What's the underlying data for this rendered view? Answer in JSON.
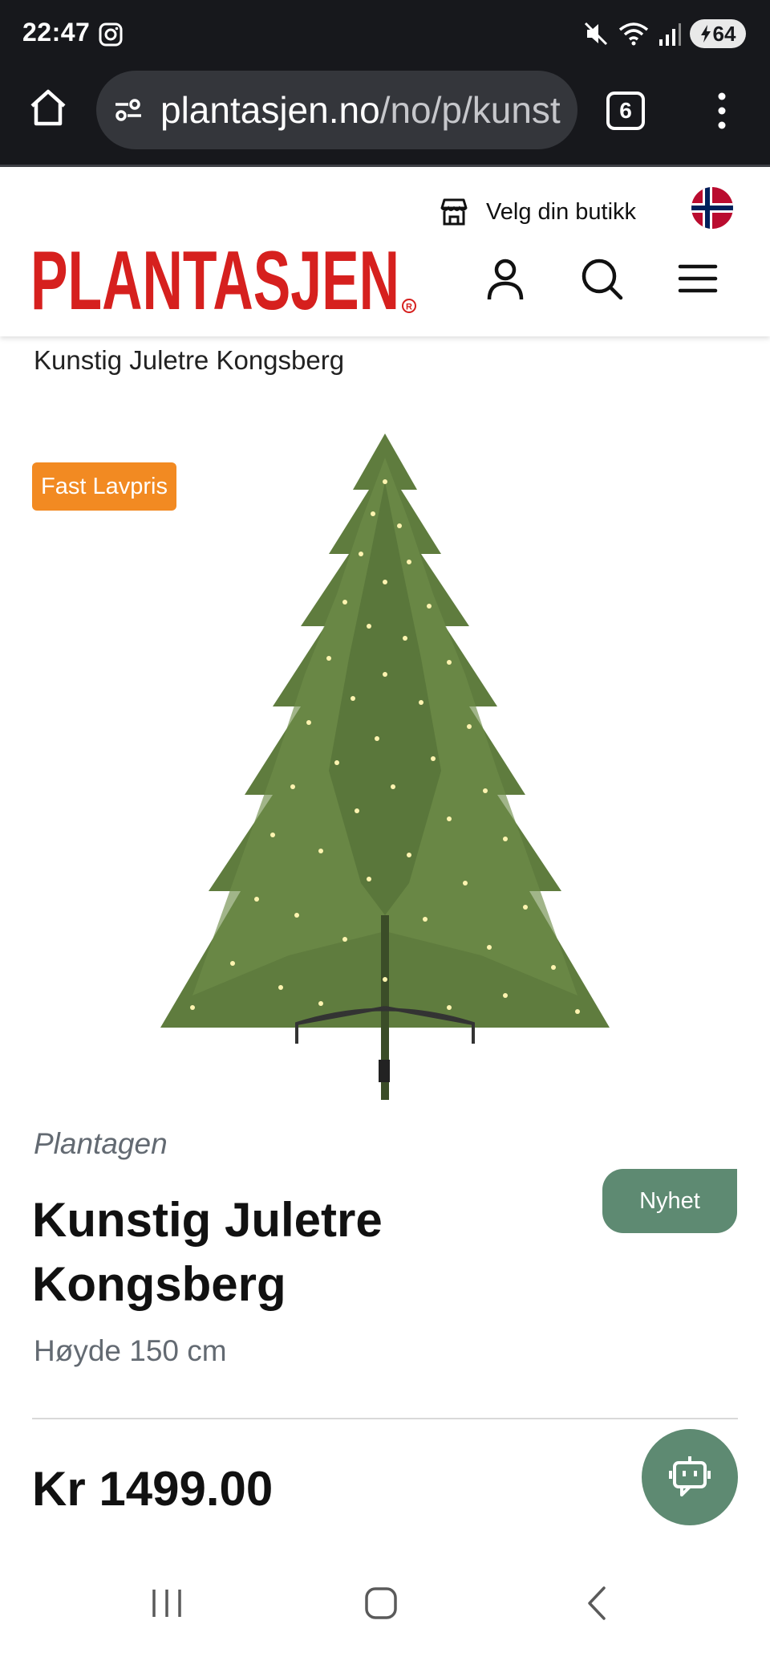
{
  "status_bar": {
    "time": "22:47",
    "battery": "64",
    "icons": [
      "instagram-icon",
      "mute-icon",
      "wifi-icon",
      "signal-icon",
      "battery-charging-icon"
    ]
  },
  "browser": {
    "url_host": "plantasjen.no",
    "url_path": "/no/p/kunstig-juletre-kongsberg",
    "tab_count": "6"
  },
  "header": {
    "store_label": "Velg din butikk",
    "logo_text": "PLANTASJEN",
    "icons": [
      "account-icon",
      "search-icon",
      "menu-icon"
    ]
  },
  "breadcrumb": "Kunstig Juletre Kongsberg",
  "product": {
    "badge": "Fast Lavpris",
    "brand": "Plantagen",
    "title": "Kunstig Juletre Kongsberg",
    "tag": "Nyhet",
    "subtitle": "Høyde 150 cm",
    "price": "Kr 1499.00"
  },
  "colors": {
    "brand_red": "#d6201e",
    "badge_orange": "#f28a22",
    "accent_green": "#5e8a72",
    "browser_bg": "#17181c"
  }
}
